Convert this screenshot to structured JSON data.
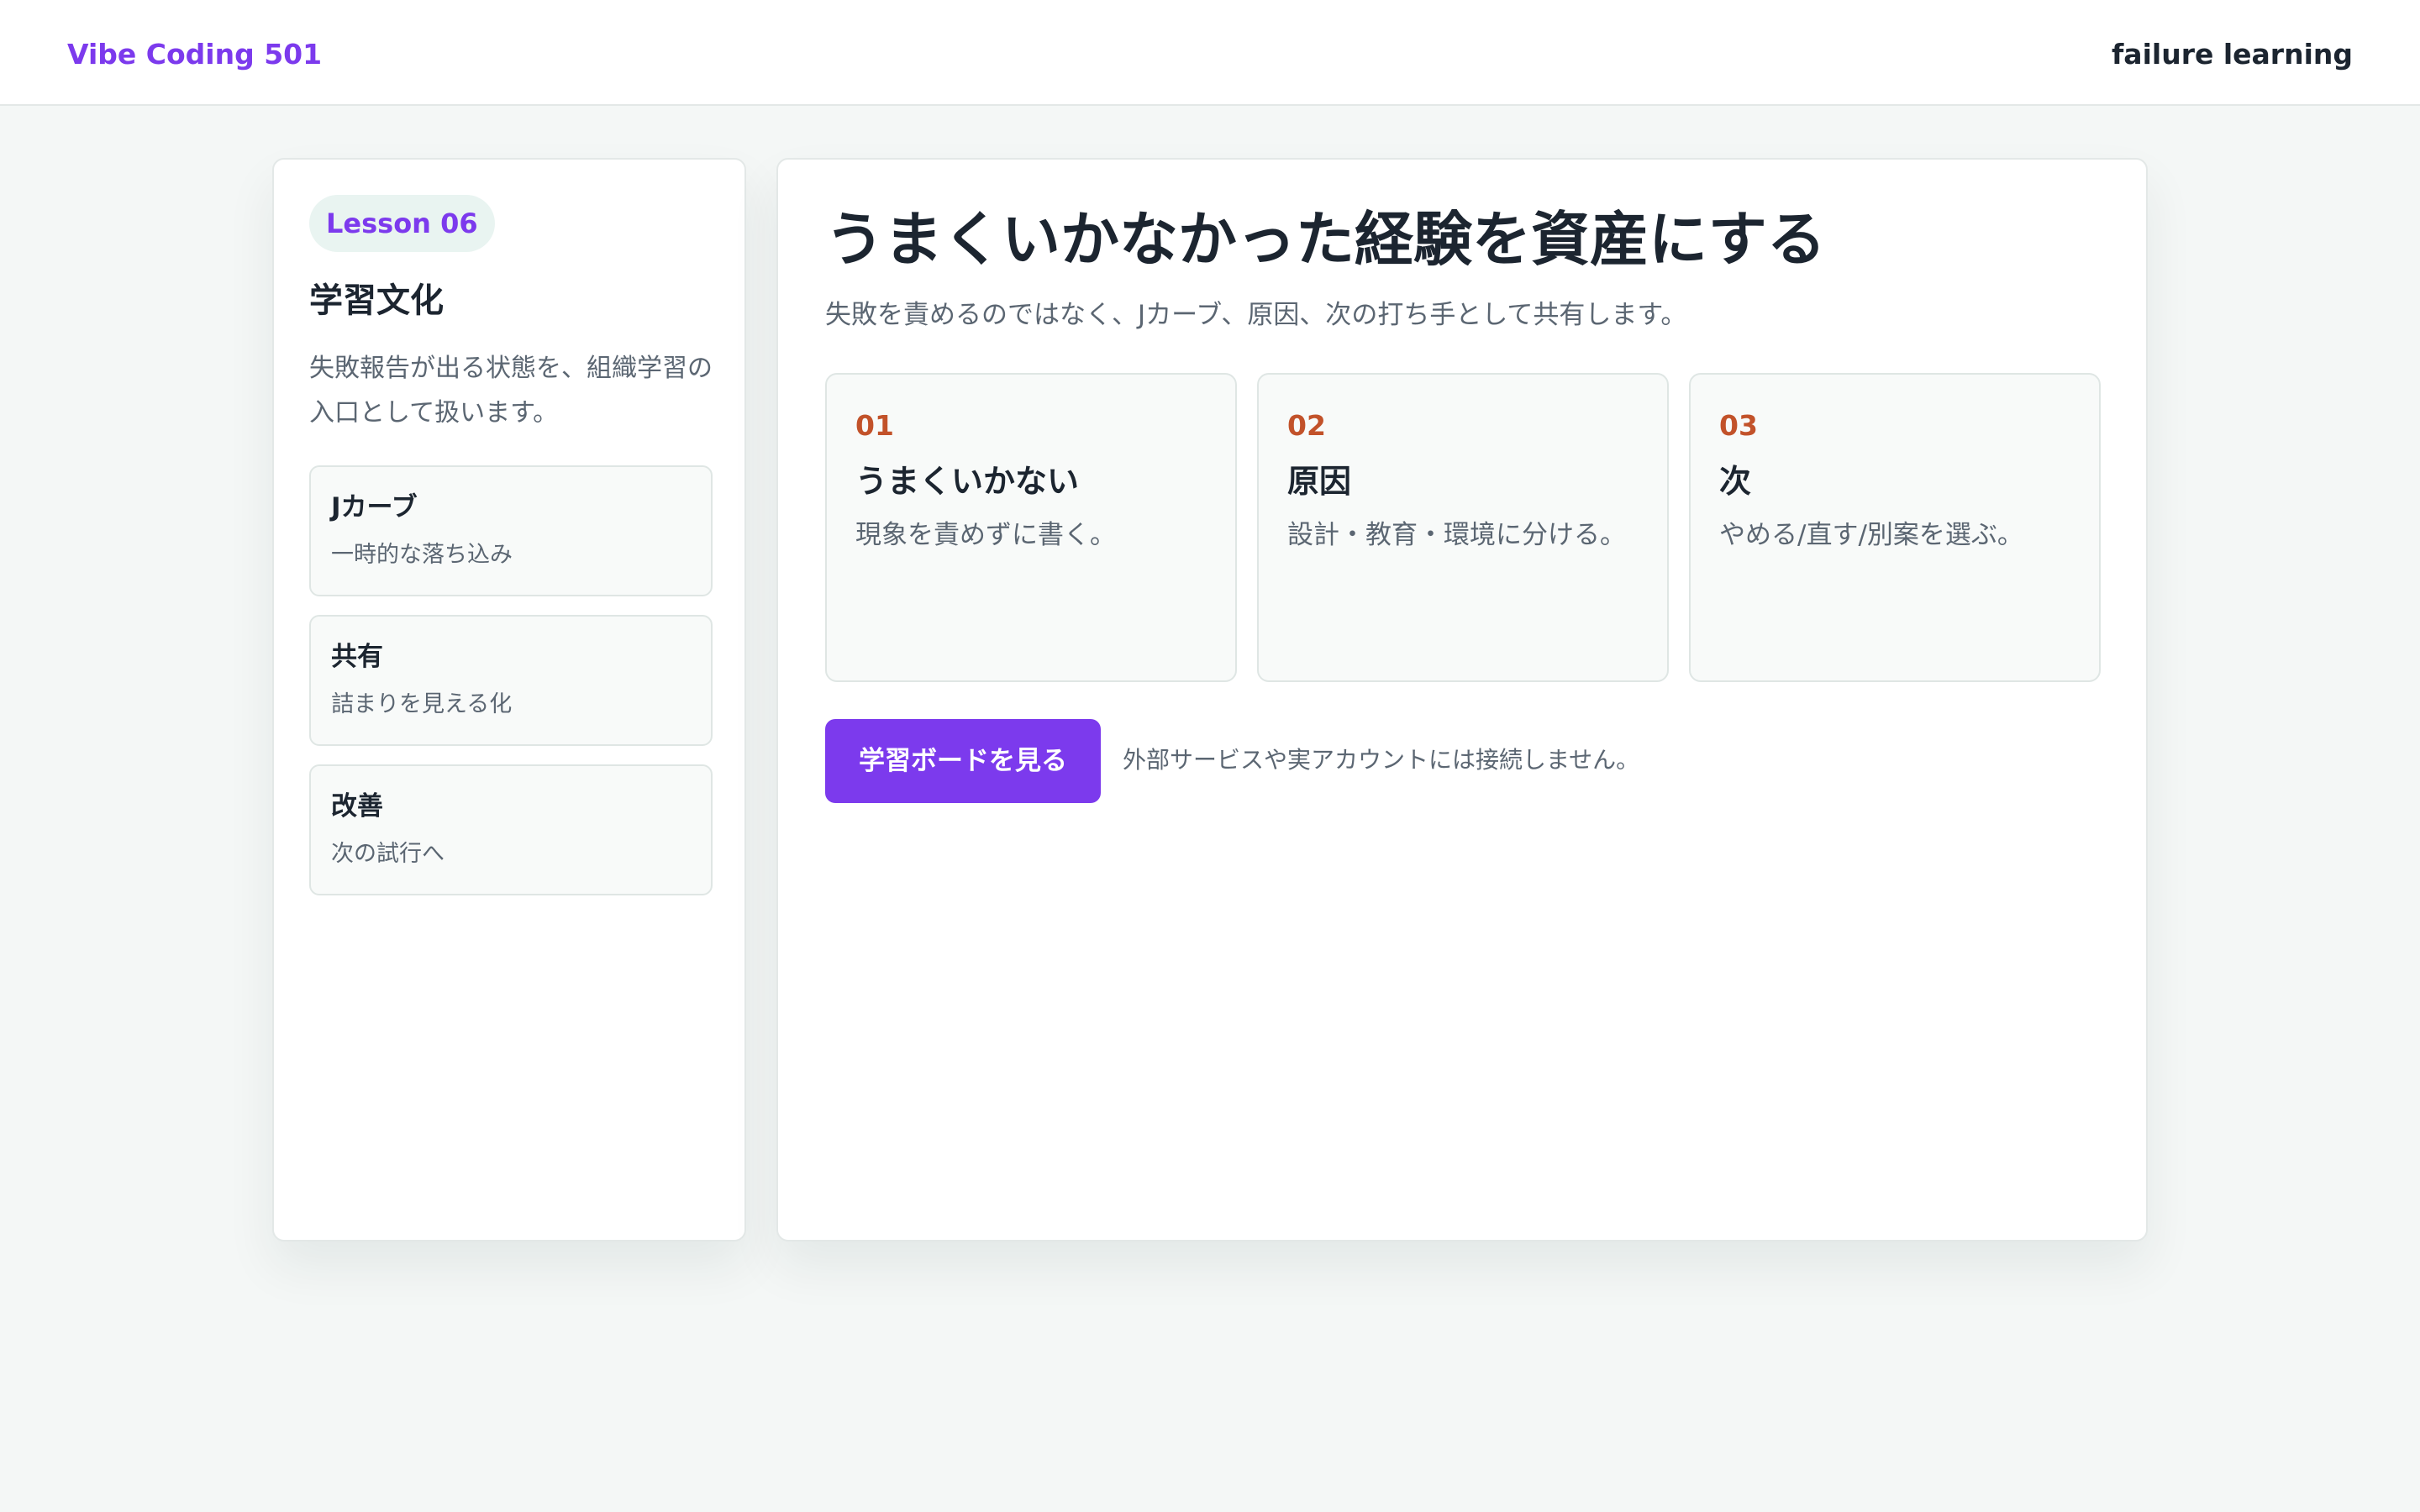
{
  "header": {
    "brand": "Vibe Coding 501",
    "topic": "failure learning"
  },
  "sidebar": {
    "badge": "Lesson 06",
    "title": "学習文化",
    "description": "失敗報告が出る状態を、組織学習の入口として扱います。",
    "items": [
      {
        "title": "Jカーブ",
        "subtitle": "一時的な落ち込み"
      },
      {
        "title": "共有",
        "subtitle": "詰まりを見える化"
      },
      {
        "title": "改善",
        "subtitle": "次の試行へ"
      }
    ]
  },
  "main": {
    "title": "うまくいかなかった経験を資産にする",
    "subtitle": "失敗を責めるのではなく、Jカーブ、原因、次の打ち手として共有します。",
    "steps": [
      {
        "num": "01",
        "title": "うまくいかない",
        "desc": "現象を責めずに書く。"
      },
      {
        "num": "02",
        "title": "原因",
        "desc": "設計・教育・環境に分ける。"
      },
      {
        "num": "03",
        "title": "次",
        "desc": "やめる/直す/別案を選ぶ。"
      }
    ],
    "cta_label": "学習ボードを見る",
    "cta_note": "外部サービスや実アカウントには接続しません。"
  },
  "colors": {
    "accent": "#7c3aed",
    "step_number": "#c2522a",
    "background": "#f4f7f6"
  }
}
